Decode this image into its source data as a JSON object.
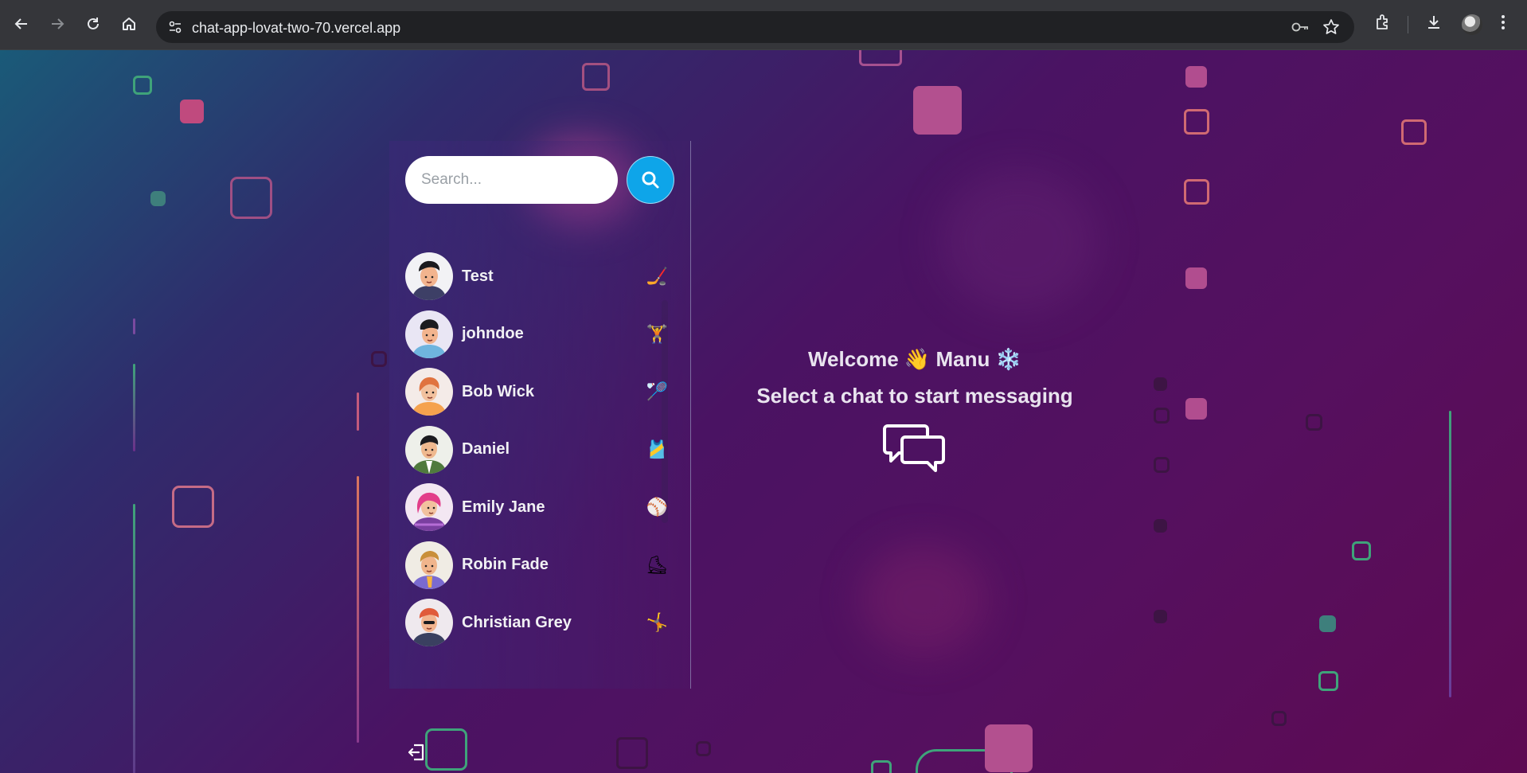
{
  "browser": {
    "url": "chat-app-lovat-two-70.vercel.app"
  },
  "sidebar": {
    "search_placeholder": "Search...",
    "contacts": [
      {
        "name": "Test",
        "emoji": "🏒"
      },
      {
        "name": "johndoe",
        "emoji": "🏋"
      },
      {
        "name": "Bob Wick",
        "emoji": "🏸"
      },
      {
        "name": "Daniel",
        "emoji": "🎽"
      },
      {
        "name": "Emily Jane",
        "emoji": "⚾"
      },
      {
        "name": "Robin Fade",
        "emoji": "⛸"
      },
      {
        "name": "Christian Grey",
        "emoji": "🤸"
      }
    ]
  },
  "welcome": {
    "greeting": "Welcome",
    "wave_emoji": "👋",
    "user": "Manu",
    "user_emoji": "❄️",
    "subtitle": "Select a chat to start messaging"
  },
  "colors": {
    "accent": "#0ea5e9",
    "background_start": "#1a5a78",
    "background_end": "#5e0a52"
  }
}
